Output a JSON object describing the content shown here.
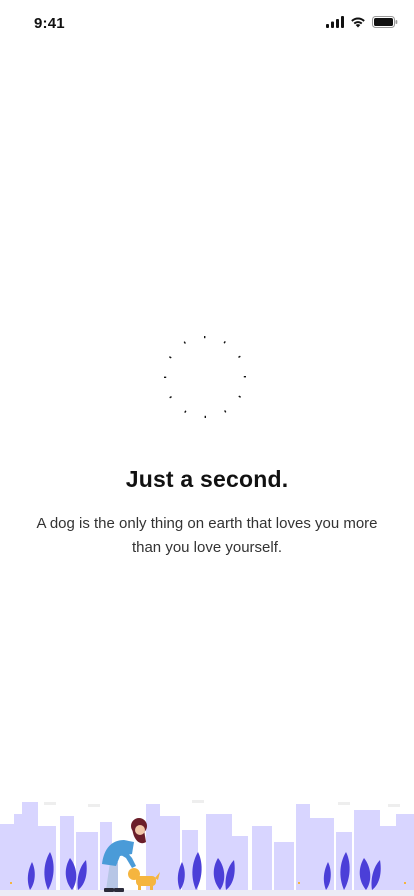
{
  "status_bar": {
    "time": "9:41",
    "icons": [
      "cellular-signal-icon",
      "wifi-icon",
      "battery-icon"
    ]
  },
  "loading": {
    "title": "Just a second.",
    "quote": "A dog is the only thing on earth that loves you more than you love yourself."
  },
  "colors": {
    "background": "#ffffff",
    "text": "#111111",
    "skyline": "#d6d3ff",
    "plant": "#4b3fd8",
    "dog": "#f5b53f",
    "person_shirt": "#4a9bd8",
    "person_pants": "#b7c6e6",
    "person_hair": "#6b1f2a"
  },
  "illustration": {
    "description_icon": "person-walking-dog-illustration"
  }
}
